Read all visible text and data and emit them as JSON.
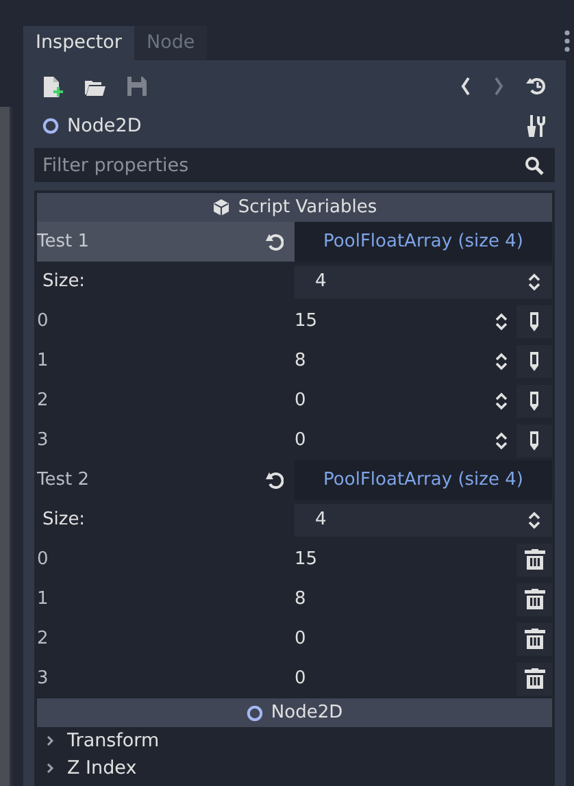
{
  "tabs": [
    {
      "label": "Inspector",
      "selected": true
    },
    {
      "label": "Node",
      "selected": false
    }
  ],
  "node": {
    "name": "Node2D"
  },
  "filter": {
    "placeholder": "Filter properties"
  },
  "section": {
    "title": "Script Variables"
  },
  "properties": [
    {
      "name": "Test 1",
      "selected": true,
      "value": "PoolFloatArray (size 4)",
      "size_label": "Size:",
      "size": "4",
      "kind": "spin",
      "items": [
        {
          "index": "0",
          "value": "15"
        },
        {
          "index": "1",
          "value": "8"
        },
        {
          "index": "2",
          "value": "0"
        },
        {
          "index": "3",
          "value": "0"
        }
      ]
    },
    {
      "name": "Test 2",
      "selected": false,
      "value": "PoolFloatArray (size 4)",
      "size_label": "Size:",
      "size": "4",
      "kind": "delete",
      "items": [
        {
          "index": "0",
          "value": "15"
        },
        {
          "index": "1",
          "value": "8"
        },
        {
          "index": "2",
          "value": "0"
        },
        {
          "index": "3",
          "value": "0"
        }
      ]
    }
  ],
  "class_section": {
    "title": "Node2D"
  },
  "groups": [
    {
      "label": "Transform",
      "expanded": false
    },
    {
      "label": "Z Index",
      "expanded": false
    }
  ]
}
